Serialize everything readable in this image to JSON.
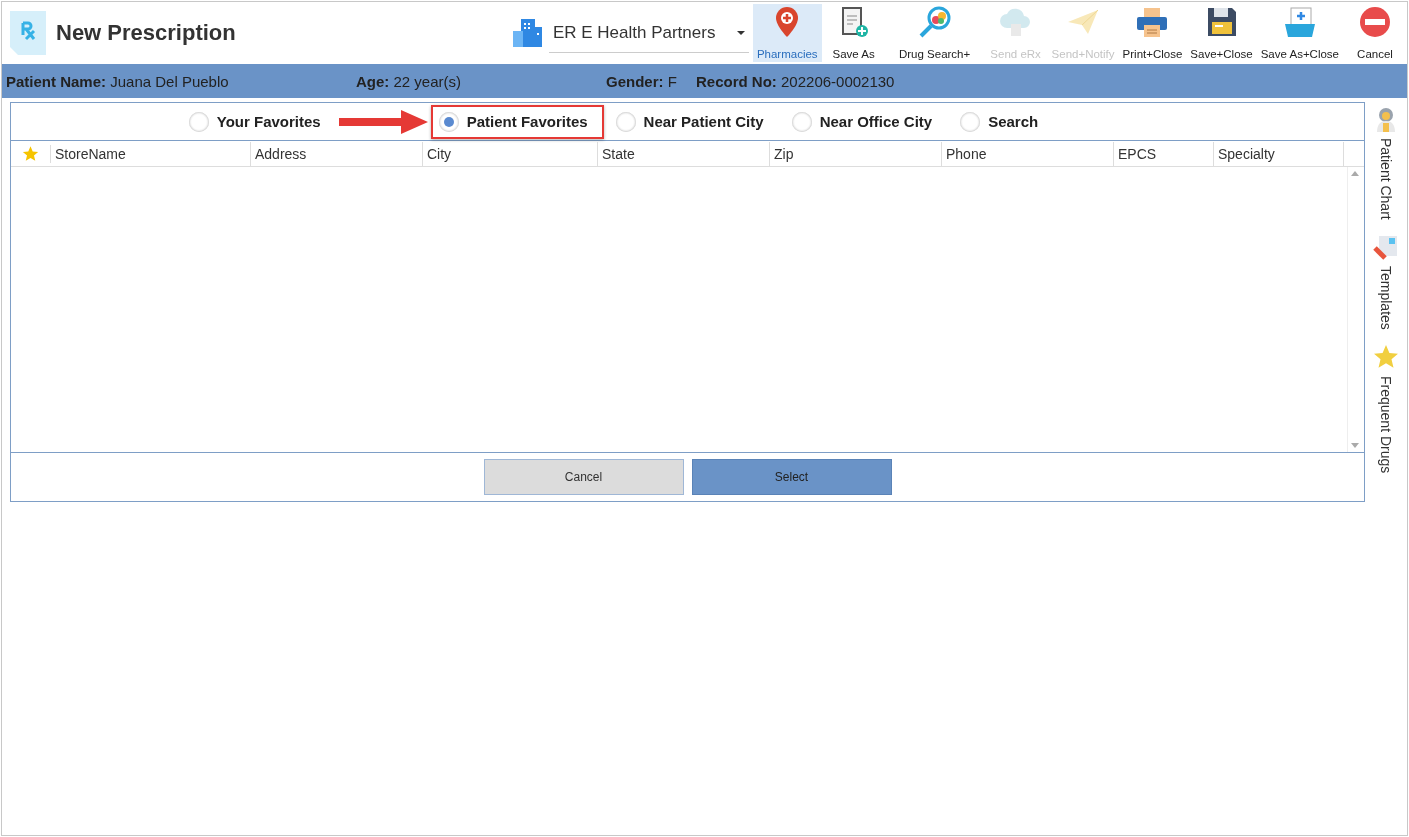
{
  "window": {
    "title": "New Prescription"
  },
  "practice": {
    "name": "ER E Health Partners"
  },
  "toolbar": [
    {
      "kind": "pin",
      "label": "Pharmacies",
      "selected": true,
      "disabled": false
    },
    {
      "kind": "clipboard",
      "label": "Save As",
      "selected": false,
      "disabled": false
    },
    {
      "kind": "magnifier",
      "label": "Drug Search+",
      "selected": false,
      "disabled": false
    },
    {
      "kind": "cloud",
      "label": "Send eRx",
      "selected": false,
      "disabled": true
    },
    {
      "kind": "plane",
      "label": "Send+Notify",
      "selected": false,
      "disabled": true
    },
    {
      "kind": "printer",
      "label": "Print+Close",
      "selected": false,
      "disabled": false
    },
    {
      "kind": "floppy",
      "label": "Save+Close",
      "selected": false,
      "disabled": false
    },
    {
      "kind": "folder",
      "label": "Save As+Close",
      "selected": false,
      "disabled": false
    },
    {
      "kind": "stop",
      "label": "Cancel",
      "selected": false,
      "disabled": false
    }
  ],
  "patient_bar": [
    {
      "label": "Patient Name:",
      "value": "Juana Del Pueblo"
    },
    {
      "label": "Age:",
      "value": "22 year(s)"
    },
    {
      "label": "Gender:",
      "value": "F"
    },
    {
      "label": "Record No:",
      "value": "202206-0002130"
    }
  ],
  "source_options": [
    {
      "label": "Your Favorites",
      "selected": false,
      "highlighted": false
    },
    {
      "label": "Patient Favorites",
      "selected": true,
      "highlighted": true
    },
    {
      "label": "Near Patient City",
      "selected": false,
      "highlighted": false
    },
    {
      "label": "Near Office City",
      "selected": false,
      "highlighted": false
    },
    {
      "label": "Search",
      "selected": false,
      "highlighted": false
    }
  ],
  "table": {
    "columns": [
      "StoreName",
      "Address",
      "City",
      "State",
      "Zip",
      "Phone",
      "EPCS",
      "Specialty"
    ]
  },
  "dialog_buttons": [
    {
      "kind": "secondary",
      "label": "Cancel"
    },
    {
      "kind": "primary",
      "label": "Select"
    }
  ],
  "side_tabs": [
    {
      "kind": "doctor",
      "label": "Patient Chart"
    },
    {
      "kind": "pencil",
      "label": "Templates"
    },
    {
      "kind": "star",
      "label": "Frequent Drugs"
    }
  ]
}
